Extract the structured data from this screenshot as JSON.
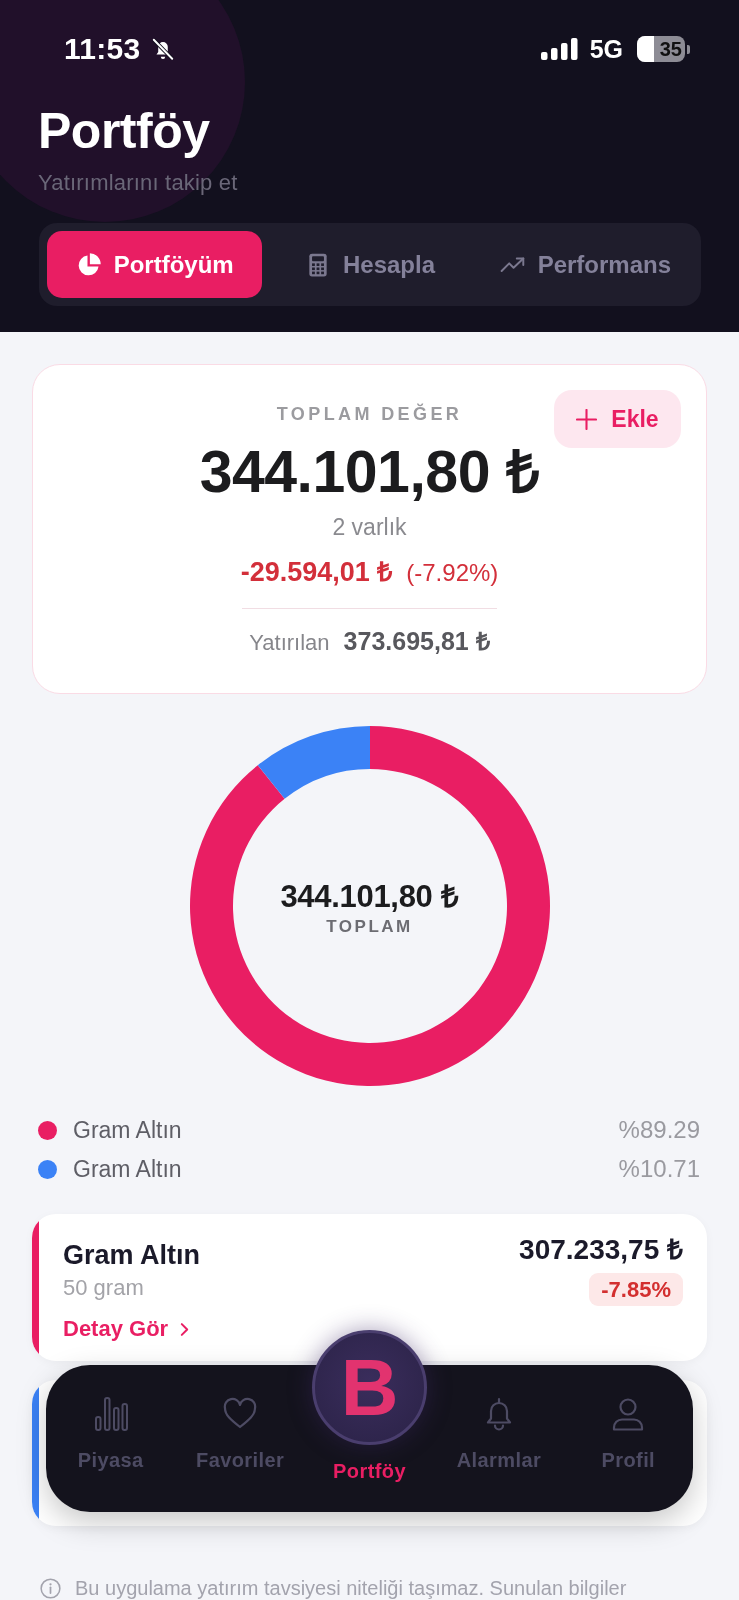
{
  "status_bar": {
    "time": "11:53",
    "network": "5G",
    "battery": "35"
  },
  "header": {
    "title": "Portföy",
    "subtitle": "Yatırımlarını takip et"
  },
  "tabs": [
    {
      "label": "Portföyüm",
      "selected": true
    },
    {
      "label": "Hesapla",
      "selected": false
    },
    {
      "label": "Performans",
      "selected": false
    }
  ],
  "summary": {
    "label": "TOPLAM DEĞER",
    "add_button": "Ekle",
    "value": "344.101,80 ₺",
    "count": "2 varlık",
    "change": "-29.594,01 ₺",
    "change_percent": "(-7.92%)",
    "invested_label": "Yatırılan",
    "invested": "373.695,81 ₺"
  },
  "allocation": {
    "center_value": "344.101,80 ₺",
    "center_label": "TOPLAM",
    "chart_data": {
      "type": "donut",
      "categories": [
        "Gram Altın",
        "Gram Altın"
      ],
      "values": [
        89.29,
        10.71
      ]
    },
    "legend": [
      {
        "share": "%89.29",
        "color": "#e91e63"
      },
      {
        "share": "%10.71",
        "color": "#3b82f6"
      }
    ]
  },
  "assets": [
    {
      "name": "Gram Altın",
      "amount": "50 gram",
      "value": "307.233,75 ₺",
      "change": "-7.85%",
      "link": "Detay Gör",
      "color": "#e91e63"
    },
    {
      "color": "#3b82f6"
    }
  ],
  "nav": [
    {
      "kind": "tab",
      "label": "Piyasa",
      "selected": false
    },
    {
      "kind": "tab",
      "label": "Favoriler",
      "selected": false
    },
    {
      "kind": "center",
      "logo": "B",
      "label": "Portföy",
      "selected": true
    },
    {
      "kind": "tab",
      "label": "Alarmlar",
      "selected": false
    },
    {
      "kind": "tab",
      "label": "Profil",
      "selected": false
    }
  ],
  "disclaimer": "Bu uygulama yatırım tavsiyesi niteliği taşımaz. Sunulan bilgiler"
}
